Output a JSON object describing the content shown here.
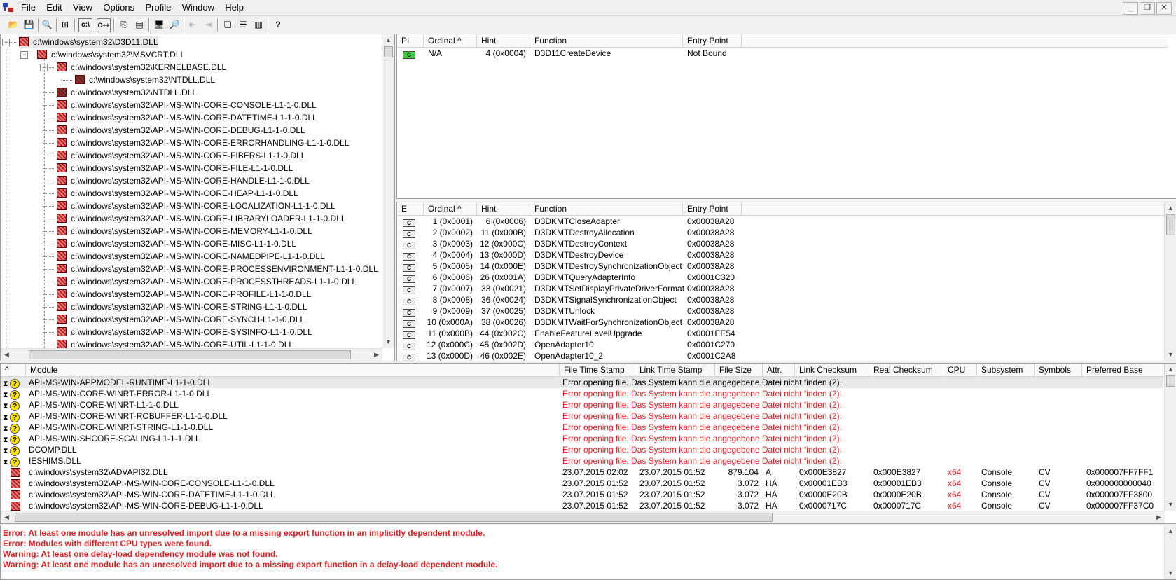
{
  "menu": {
    "items": [
      "File",
      "Edit",
      "View",
      "Options",
      "Profile",
      "Window",
      "Help"
    ]
  },
  "toolbar": {
    "cx_label": "c:\\",
    "cpp_label": "C++"
  },
  "tree": {
    "items": [
      {
        "text": "c:\\windows\\system32\\D3D11.DLL",
        "level": 0
      },
      {
        "text": "c:\\windows\\system32\\MSVCRT.DLL",
        "level": 1
      },
      {
        "text": "c:\\windows\\system32\\KERNELBASE.DLL",
        "level": 2
      },
      {
        "text": "c:\\windows\\system32\\NTDLL.DLL",
        "level": 3
      },
      {
        "text": "c:\\windows\\system32\\NTDLL.DLL",
        "level": 2
      },
      {
        "text": "c:\\windows\\system32\\API-MS-WIN-CORE-CONSOLE-L1-1-0.DLL",
        "level": 2
      },
      {
        "text": "c:\\windows\\system32\\API-MS-WIN-CORE-DATETIME-L1-1-0.DLL",
        "level": 2
      },
      {
        "text": "c:\\windows\\system32\\API-MS-WIN-CORE-DEBUG-L1-1-0.DLL",
        "level": 2
      },
      {
        "text": "c:\\windows\\system32\\API-MS-WIN-CORE-ERRORHANDLING-L1-1-0.DLL",
        "level": 2
      },
      {
        "text": "c:\\windows\\system32\\API-MS-WIN-CORE-FIBERS-L1-1-0.DLL",
        "level": 2
      },
      {
        "text": "c:\\windows\\system32\\API-MS-WIN-CORE-FILE-L1-1-0.DLL",
        "level": 2
      },
      {
        "text": "c:\\windows\\system32\\API-MS-WIN-CORE-HANDLE-L1-1-0.DLL",
        "level": 2
      },
      {
        "text": "c:\\windows\\system32\\API-MS-WIN-CORE-HEAP-L1-1-0.DLL",
        "level": 2
      },
      {
        "text": "c:\\windows\\system32\\API-MS-WIN-CORE-LOCALIZATION-L1-1-0.DLL",
        "level": 2
      },
      {
        "text": "c:\\windows\\system32\\API-MS-WIN-CORE-LIBRARYLOADER-L1-1-0.DLL",
        "level": 2
      },
      {
        "text": "c:\\windows\\system32\\API-MS-WIN-CORE-MEMORY-L1-1-0.DLL",
        "level": 2
      },
      {
        "text": "c:\\windows\\system32\\API-MS-WIN-CORE-MISC-L1-1-0.DLL",
        "level": 2
      },
      {
        "text": "c:\\windows\\system32\\API-MS-WIN-CORE-NAMEDPIPE-L1-1-0.DLL",
        "level": 2
      },
      {
        "text": "c:\\windows\\system32\\API-MS-WIN-CORE-PROCESSENVIRONMENT-L1-1-0.DLL",
        "level": 2
      },
      {
        "text": "c:\\windows\\system32\\API-MS-WIN-CORE-PROCESSTHREADS-L1-1-0.DLL",
        "level": 2
      },
      {
        "text": "c:\\windows\\system32\\API-MS-WIN-CORE-PROFILE-L1-1-0.DLL",
        "level": 2
      },
      {
        "text": "c:\\windows\\system32\\API-MS-WIN-CORE-STRING-L1-1-0.DLL",
        "level": 2
      },
      {
        "text": "c:\\windows\\system32\\API-MS-WIN-CORE-SYNCH-L1-1-0.DLL",
        "level": 2
      },
      {
        "text": "c:\\windows\\system32\\API-MS-WIN-CORE-SYSINFO-L1-1-0.DLL",
        "level": 2
      },
      {
        "text": "c:\\windows\\system32\\API-MS-WIN-CORE-UTIL-L1-1-0.DLL",
        "level": 2
      }
    ]
  },
  "imports": {
    "columns": [
      "PI",
      "Ordinal ^",
      "Hint",
      "Function",
      "Entry Point"
    ],
    "rows": [
      {
        "ordinal": "N/A",
        "hint": "4 (0x0004)",
        "function": "D3D11CreateDevice",
        "entry": "Not Bound"
      }
    ]
  },
  "exports": {
    "columns": [
      "E",
      "Ordinal ^",
      "Hint",
      "Function",
      "Entry Point"
    ],
    "rows": [
      {
        "ordinal": "1 (0x0001)",
        "hint": "6 (0x0006)",
        "function": "D3DKMTCloseAdapter",
        "entry": "0x00038A28"
      },
      {
        "ordinal": "2 (0x0002)",
        "hint": "11 (0x000B)",
        "function": "D3DKMTDestroyAllocation",
        "entry": "0x00038A28"
      },
      {
        "ordinal": "3 (0x0003)",
        "hint": "12 (0x000C)",
        "function": "D3DKMTDestroyContext",
        "entry": "0x00038A28"
      },
      {
        "ordinal": "4 (0x0004)",
        "hint": "13 (0x000D)",
        "function": "D3DKMTDestroyDevice",
        "entry": "0x00038A28"
      },
      {
        "ordinal": "5 (0x0005)",
        "hint": "14 (0x000E)",
        "function": "D3DKMTDestroySynchronizationObject",
        "entry": "0x00038A28"
      },
      {
        "ordinal": "6 (0x0006)",
        "hint": "26 (0x001A)",
        "function": "D3DKMTQueryAdapterInfo",
        "entry": "0x0001C320"
      },
      {
        "ordinal": "7 (0x0007)",
        "hint": "33 (0x0021)",
        "function": "D3DKMTSetDisplayPrivateDriverFormat",
        "entry": "0x00038A28"
      },
      {
        "ordinal": "8 (0x0008)",
        "hint": "36 (0x0024)",
        "function": "D3DKMTSignalSynchronizationObject",
        "entry": "0x00038A28"
      },
      {
        "ordinal": "9 (0x0009)",
        "hint": "37 (0x0025)",
        "function": "D3DKMTUnlock",
        "entry": "0x00038A28"
      },
      {
        "ordinal": "10 (0x000A)",
        "hint": "38 (0x0026)",
        "function": "D3DKMTWaitForSynchronizationObject",
        "entry": "0x00038A28"
      },
      {
        "ordinal": "11 (0x000B)",
        "hint": "44 (0x002C)",
        "function": "EnableFeatureLevelUpgrade",
        "entry": "0x0001EE54"
      },
      {
        "ordinal": "12 (0x000C)",
        "hint": "45 (0x002D)",
        "function": "OpenAdapter10",
        "entry": "0x0001C270"
      },
      {
        "ordinal": "13 (0x000D)",
        "hint": "46 (0x002E)",
        "function": "OpenAdapter10_2",
        "entry": "0x0001C2A8"
      }
    ]
  },
  "modules": {
    "columns": [
      "^",
      "Module",
      "File Time Stamp",
      "Link Time Stamp",
      "File Size",
      "Attr.",
      "Link Checksum",
      "Real Checksum",
      "CPU",
      "Subsystem",
      "Symbols",
      "Preferred Base"
    ],
    "missing": [
      {
        "name": "API-MS-WIN-APPMODEL-RUNTIME-L1-1-0.DLL",
        "error": "Error opening file. Das System kann die angegebene Datei nicht finden (2).",
        "selected": true
      },
      {
        "name": "API-MS-WIN-CORE-WINRT-ERROR-L1-1-0.DLL",
        "error": "Error opening file. Das System kann die angegebene Datei nicht finden (2)."
      },
      {
        "name": "API-MS-WIN-CORE-WINRT-L1-1-0.DLL",
        "error": "Error opening file. Das System kann die angegebene Datei nicht finden (2)."
      },
      {
        "name": "API-MS-WIN-CORE-WINRT-ROBUFFER-L1-1-0.DLL",
        "error": "Error opening file. Das System kann die angegebene Datei nicht finden (2)."
      },
      {
        "name": "API-MS-WIN-CORE-WINRT-STRING-L1-1-0.DLL",
        "error": "Error opening file. Das System kann die angegebene Datei nicht finden (2)."
      },
      {
        "name": "API-MS-WIN-SHCORE-SCALING-L1-1-1.DLL",
        "error": "Error opening file. Das System kann die angegebene Datei nicht finden (2)."
      },
      {
        "name": "DCOMP.DLL",
        "error": "Error opening file. Das System kann die angegebene Datei nicht finden (2)."
      },
      {
        "name": "IESHIMS.DLL",
        "error": "Error opening file. Das System kann die angegebene Datei nicht finden (2)."
      }
    ],
    "found": [
      {
        "name": "c:\\windows\\system32\\ADVAPI32.DLL",
        "fts": "23.07.2015 02:02",
        "lts": "23.07.2015 01:52",
        "size": "879.104",
        "attr": "A",
        "lcs": "0x000E3827",
        "rcs": "0x000E3827",
        "cpu": "x64",
        "sub": "Console",
        "sym": "CV",
        "base": "0x000007FF7FF1"
      },
      {
        "name": "c:\\windows\\system32\\API-MS-WIN-CORE-CONSOLE-L1-1-0.DLL",
        "fts": "23.07.2015 01:52",
        "lts": "23.07.2015 01:52",
        "size": "3.072",
        "attr": "HA",
        "lcs": "0x00001EB3",
        "rcs": "0x00001EB3",
        "cpu": "x64",
        "sub": "Console",
        "sym": "CV",
        "base": "0x000000000040"
      },
      {
        "name": "c:\\windows\\system32\\API-MS-WIN-CORE-DATETIME-L1-1-0.DLL",
        "fts": "23.07.2015 01:52",
        "lts": "23.07.2015 01:52",
        "size": "3.072",
        "attr": "HA",
        "lcs": "0x0000E20B",
        "rcs": "0x0000E20B",
        "cpu": "x64",
        "sub": "Console",
        "sym": "CV",
        "base": "0x000007FF3800"
      },
      {
        "name": "c:\\windows\\system32\\API-MS-WIN-CORE-DEBUG-L1-1-0.DLL",
        "fts": "23.07.2015 01:52",
        "lts": "23.07.2015 01:52",
        "size": "3.072",
        "attr": "HA",
        "lcs": "0x0000717C",
        "rcs": "0x0000717C",
        "cpu": "x64",
        "sub": "Console",
        "sym": "CV",
        "base": "0x000007FF37C0"
      }
    ]
  },
  "log": [
    "Error: At least one module has an unresolved import due to a missing export function in an implicitly dependent module.",
    "Error: Modules with different CPU types were found.",
    "Warning: At least one delay-load dependency module was not found.",
    "Warning: At least one module has an unresolved import due to a missing export function in a delay-load dependent module."
  ],
  "colors": {
    "error": "#e02020",
    "cpu_mismatch": "#e02020",
    "import_ok": "#3fcf3f"
  },
  "icons": [
    "app-icon",
    "open-icon",
    "save-icon",
    "find-icon",
    "copy-icon",
    "properties-icon",
    "help-icon"
  ]
}
